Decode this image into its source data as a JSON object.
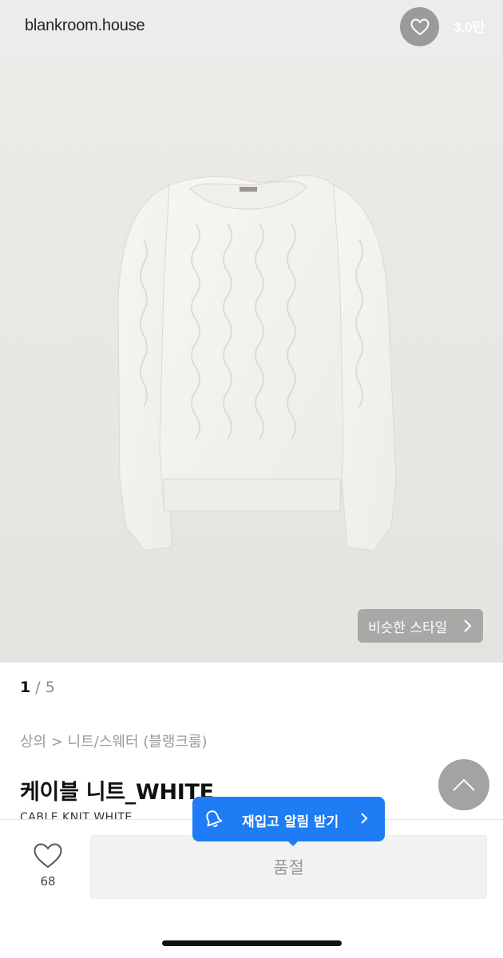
{
  "header": {
    "store_name": "blankroom.house",
    "like_count_label": "3.0만"
  },
  "image": {
    "similar_style_label": "비슷한 스타일",
    "pager_current": "1",
    "pager_total": "/ 5"
  },
  "product": {
    "breadcrumb": "상의 > 니트/스웨터 (블랭크룸)",
    "title": "케이블 니트_WHITE",
    "subtitle": "CABLE KNIT WHITE"
  },
  "bottom": {
    "wish_count": "68",
    "soldout_label": "품절",
    "restock_label": "재입고 알림 받기"
  },
  "colors": {
    "accent_blue": "#1e7cf5",
    "soldout_bg": "#f2f2f2"
  }
}
